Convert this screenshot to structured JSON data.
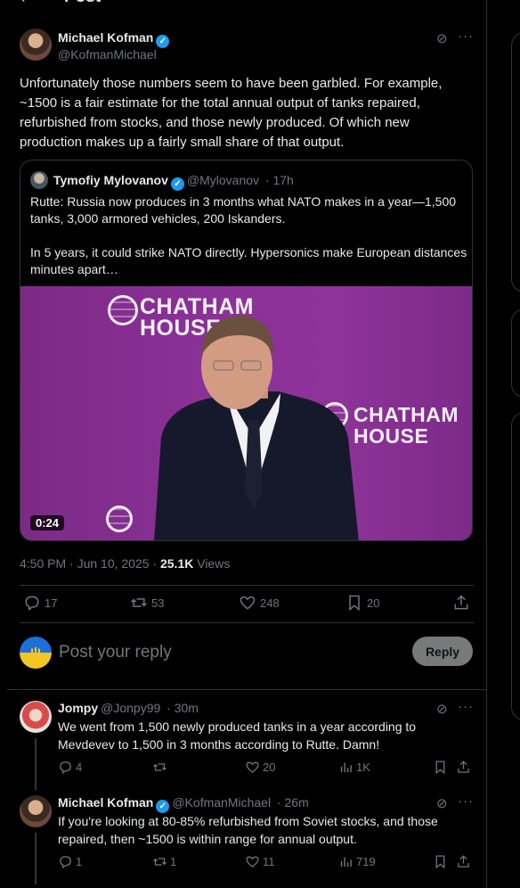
{
  "header": {
    "back_icon": "arrow-left-icon",
    "title": "Post"
  },
  "post": {
    "author_name": "Michael Kofman",
    "author_handle": "@KofmanMichael",
    "text": "Unfortunately those numbers seem to have been garbled. For example, ~1500 is a fair estimate for the total annual output of tanks repaired, refurbished from stocks, and those newly produced. Of which new production makes up a fairly small share of that output.",
    "quote": {
      "author_name": "Tymofiy Mylovanov",
      "author_handle": "@Mylovanov",
      "time": "· 17h",
      "text": "Rutte: Russia now produces in 3 months what NATO makes in a year—1,500 tanks, 3,000 armored vehicles, 200 Iskanders.\n\nIn 5 years, it could strike NATO directly. Hypersonics make European distances minutes apart…",
      "video_duration": "0:24",
      "backdrop_text_1": "CHATHAM\nHOUSE",
      "backdrop_text_2": "CHATHAM\nHOUSE"
    },
    "timestamp": "4:50 PM · Jun 10, 2025 · ",
    "views_count": "25.1K",
    "views_label": " Views",
    "stats": {
      "replies": "17",
      "reposts": "53",
      "likes": "248",
      "bookmarks": "20"
    }
  },
  "reply_box": {
    "placeholder": "Post your reply",
    "button": "Reply"
  },
  "replies": [
    {
      "name": "Jompy",
      "handle": "@Jonpy99",
      "time": "· 30m",
      "text": "We went from 1,500 newly produced tanks in a year according to Mevdevev to 1,500 in 3 months according to Rutte. Damn!",
      "replies": "4",
      "reposts": "",
      "likes": "20",
      "views": "1K"
    },
    {
      "name": "Michael Kofman",
      "handle": "@KofmanMichael",
      "time": "· 26m",
      "text": "If you're looking at 80-85% refurbished from Soviet stocks, and those repaired, then ~1500 is within range for annual output.",
      "replies": "1",
      "reposts": "1",
      "likes": "11",
      "views": "719"
    }
  ],
  "colors": {
    "background": "#000000",
    "text": "#e7e9ea",
    "muted": "#71767b",
    "border": "#2f3336",
    "verified": "#1d9bf0",
    "video_backdrop": "#8a3197"
  }
}
